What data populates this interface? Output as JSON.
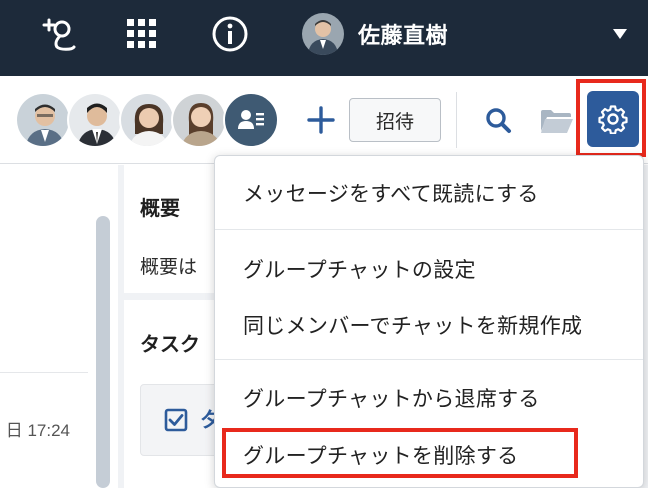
{
  "header": {
    "user_name": "佐藤直樹",
    "icons": [
      "add-contact-icon",
      "apps-grid-icon",
      "info-icon",
      "caret-down-icon"
    ]
  },
  "toolbar": {
    "members": [
      "member-avatar-1",
      "member-avatar-2",
      "member-avatar-3",
      "member-avatar-4"
    ],
    "invite_label": "招待",
    "icons": [
      "member-list-icon",
      "plus-icon",
      "search-icon",
      "folder-icon",
      "gear-icon"
    ]
  },
  "panel": {
    "summary_title": "概要",
    "summary_text": "概要は",
    "tasks_title": "タスク",
    "task_item_label": "タ"
  },
  "left": {
    "timestamp": "日 17:24"
  },
  "menu": {
    "items": [
      "メッセージをすべて既読にする",
      "グループチャットの設定",
      "同じメンバーでチャットを新規作成",
      "グループチャットから退席する",
      "グループチャットを削除する"
    ]
  },
  "colors": {
    "header_bg": "#1d2a3a",
    "accent": "#2d5b9b",
    "highlight": "#e8291c"
  }
}
